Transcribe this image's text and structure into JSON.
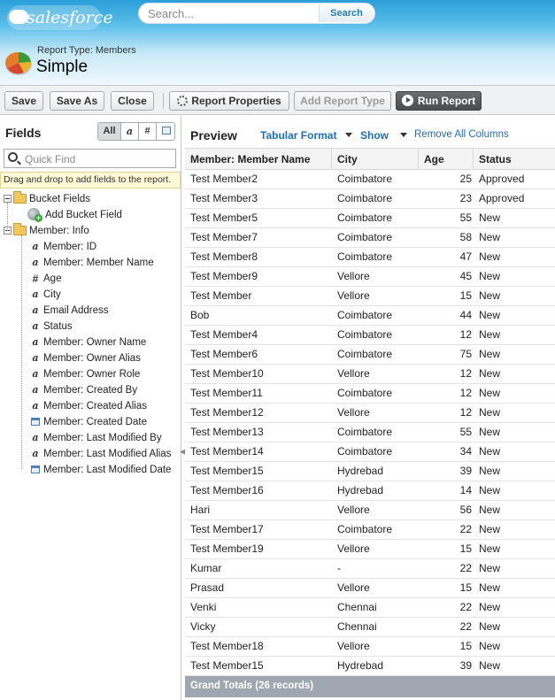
{
  "header": {
    "logo_text": "salesforce",
    "search": {
      "placeholder": "Search...",
      "button_label": "Search"
    },
    "report_type": "Report Type: Members",
    "report_name": "Simple"
  },
  "toolbar": {
    "save_label": "Save",
    "save_as_label": "Save As",
    "close_label": "Close",
    "properties_label": "Report Properties",
    "add_type_label": "Add Report Type",
    "run_label": "Run Report"
  },
  "fields_panel": {
    "title": "Fields",
    "filters": [
      "All",
      "a",
      "#",
      "date"
    ],
    "quick_find_placeholder": "Quick Find",
    "drag_hint": "Drag and drop to add fields to the report.",
    "bucket_folder": "Bucket Fields",
    "add_bucket_field": "Add Bucket Field",
    "info_folder": "Member: Info",
    "fields": [
      {
        "label": "Member: ID",
        "type": "text"
      },
      {
        "label": "Member: Member Name",
        "type": "text"
      },
      {
        "label": "Age",
        "type": "number"
      },
      {
        "label": "City",
        "type": "text"
      },
      {
        "label": "Email Address",
        "type": "text"
      },
      {
        "label": "Status",
        "type": "text"
      },
      {
        "label": "Member: Owner Name",
        "type": "text"
      },
      {
        "label": "Member: Owner Alias",
        "type": "text"
      },
      {
        "label": "Member: Owner Role",
        "type": "text"
      },
      {
        "label": "Member: Created By",
        "type": "text"
      },
      {
        "label": "Member: Created Alias",
        "type": "text"
      },
      {
        "label": "Member: Created Date",
        "type": "date"
      },
      {
        "label": "Member: Last Modified By",
        "type": "text"
      },
      {
        "label": "Member: Last Modified Alias",
        "type": "text"
      },
      {
        "label": "Member: Last Modified Date",
        "type": "date"
      }
    ]
  },
  "preview": {
    "title": "Preview",
    "format_label": "Tabular Format",
    "show_label": "Show",
    "remove_label": "Remove All Columns",
    "columns": [
      "Member: Member Name",
      "City",
      "Age",
      "Status"
    ],
    "rows": [
      [
        "Test Member2",
        "Coimbatore",
        "25",
        "Approved"
      ],
      [
        "Test Member3",
        "Coimbatore",
        "23",
        "Approved"
      ],
      [
        "Test Member5",
        "Coimbatore",
        "55",
        "New"
      ],
      [
        "Test Member7",
        "Coimbatore",
        "58",
        "New"
      ],
      [
        "Test Member8",
        "Coimbatore",
        "47",
        "New"
      ],
      [
        "Test Member9",
        "Vellore",
        "45",
        "New"
      ],
      [
        "Test Member",
        "Vellore",
        "15",
        "New"
      ],
      [
        "Bob",
        "Coimbatore",
        "44",
        "New"
      ],
      [
        "Test Member4",
        "Coimbatore",
        "12",
        "New"
      ],
      [
        "Test Member6",
        "Coimbatore",
        "75",
        "New"
      ],
      [
        "Test Member10",
        "Vellore",
        "12",
        "New"
      ],
      [
        "Test Member11",
        "Coimbatore",
        "12",
        "New"
      ],
      [
        "Test Member12",
        "Vellore",
        "12",
        "New"
      ],
      [
        "Test Member13",
        "Coimbatore",
        "55",
        "New"
      ],
      [
        "Test Member14",
        "Coimbatore",
        "34",
        "New"
      ],
      [
        "Test Member15",
        "Hydrebad",
        "39",
        "New"
      ],
      [
        "Test Member16",
        "Hydrebad",
        "14",
        "New"
      ],
      [
        "Hari",
        "Vellore",
        "56",
        "New"
      ],
      [
        "Test Member17",
        "Coimbatore",
        "22",
        "New"
      ],
      [
        "Test Member19",
        "Vellore",
        "15",
        "New"
      ],
      [
        "Kumar",
        "-",
        "22",
        "New"
      ],
      [
        "Prasad",
        "Vellore",
        "15",
        "New"
      ],
      [
        "Venki",
        "Chennai",
        "22",
        "New"
      ],
      [
        "Vicky",
        "Chennai",
        "22",
        "New"
      ],
      [
        "Test Member18",
        "Vellore",
        "15",
        "New"
      ],
      [
        "Test Member15",
        "Hydrebad",
        "39",
        "New"
      ]
    ],
    "grand_total": "Grand Totals (26 records)"
  }
}
